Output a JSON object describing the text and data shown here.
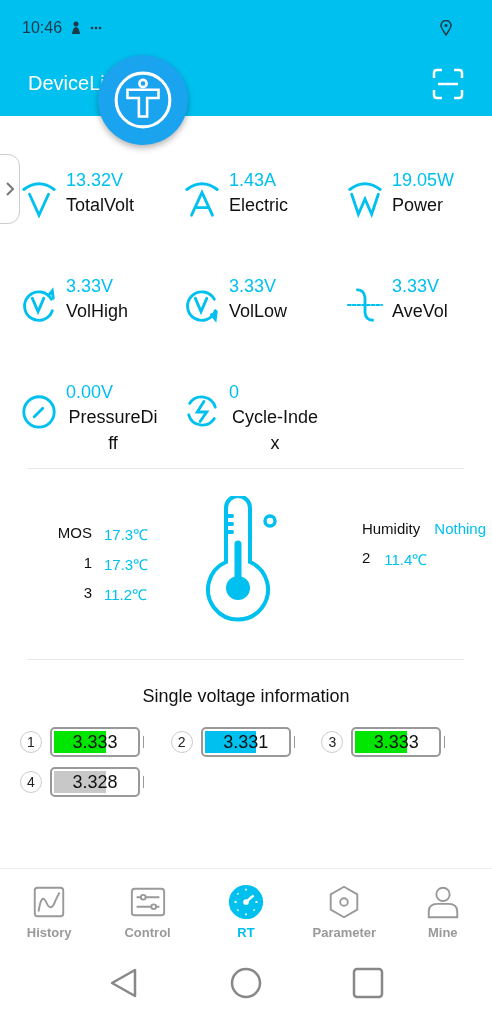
{
  "status_bar": {
    "time": "10:46"
  },
  "app_bar": {
    "title": "DeviceLi"
  },
  "metrics": [
    {
      "kind": "volt",
      "value": "13.32V",
      "label": "TotalVolt"
    },
    {
      "kind": "amp",
      "value": "1.43A",
      "label": "Electric"
    },
    {
      "kind": "watt",
      "value": "19.05W",
      "label": "Power"
    },
    {
      "kind": "high",
      "value": "3.33V",
      "label": "VolHigh"
    },
    {
      "kind": "low",
      "value": "3.33V",
      "label": "VolLow"
    },
    {
      "kind": "avg",
      "value": "3.33V",
      "label": "AveVol"
    },
    {
      "kind": "gauge",
      "value": "0.00V",
      "label": "PressureDiff"
    },
    {
      "kind": "cycle",
      "value": "0",
      "label": "Cycle-Index"
    }
  ],
  "temperatures_left": [
    {
      "label": "MOS",
      "value": "17.3℃"
    },
    {
      "label": "1",
      "value": "17.3℃"
    },
    {
      "label": "3",
      "value": "11.2℃"
    }
  ],
  "humidity": {
    "label": "Humidity",
    "value": "Nothing"
  },
  "temperatures_right": [
    {
      "label": "2",
      "value": "11.4℃"
    }
  ],
  "cells_title": "Single voltage information",
  "cells": [
    {
      "index": "1",
      "value": "3.333",
      "level": 0.6,
      "color": "#00e600"
    },
    {
      "index": "2",
      "value": "3.331",
      "level": 0.6,
      "color": "#00c0ef"
    },
    {
      "index": "3",
      "value": "3.333",
      "level": 0.6,
      "color": "#00e600"
    },
    {
      "index": "4",
      "value": "3.328",
      "level": 0.6,
      "color": "#c8c8c8"
    }
  ],
  "nav": [
    {
      "kind": "history",
      "label": "History",
      "selected": false
    },
    {
      "kind": "control",
      "label": "Control",
      "selected": false
    },
    {
      "kind": "rt",
      "label": "RT",
      "selected": true
    },
    {
      "kind": "parameter",
      "label": "Parameter",
      "selected": false
    },
    {
      "kind": "mine",
      "label": "Mine",
      "selected": false
    }
  ]
}
